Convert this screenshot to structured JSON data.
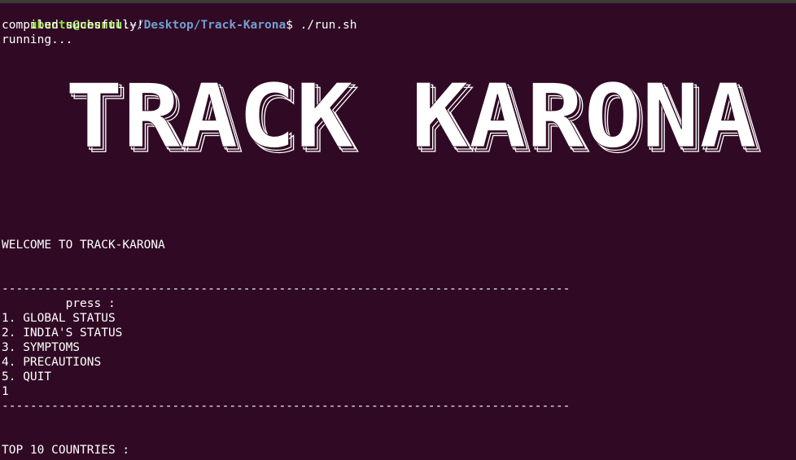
{
  "prompt": {
    "user_host": "ubuntu@ubuntu",
    "colon": ":",
    "path": "~/Desktop/Track-Karona",
    "dollar": "$",
    "command": " ./run.sh"
  },
  "output": {
    "compiled": "compiled sucesfully!",
    "running": "running...",
    "banner_text": "TRACK KARONA",
    "welcome": "WELCOME TO TRACK-KARONA",
    "divider": "--------------------------------------------------------------------------------",
    "press": "         press :",
    "menu": [
      "1. GLOBAL STATUS",
      "2. INDIA'S STATUS",
      "3. SYMPTOMS",
      "4. PRECAUTIONS",
      "5. QUIT"
    ],
    "user_input": "1",
    "top10": "TOP 10 COUNTRIES :"
  },
  "colors": {
    "background": "#300a24",
    "prompt_user": "#8ae234",
    "prompt_path": "#729fcf",
    "text": "#ffffff"
  }
}
